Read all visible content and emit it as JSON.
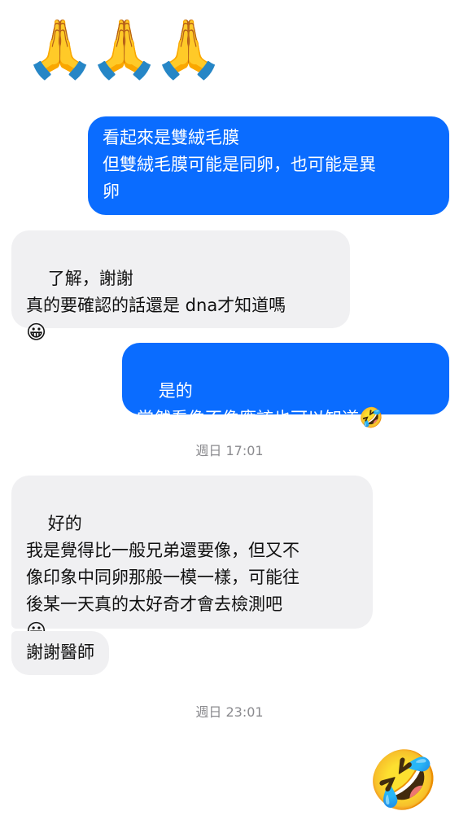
{
  "messages": {
    "m0_emoji": "🙏🙏🙏",
    "m1": "看起來是雙絨毛膜\n但雙絨毛膜可能是同卵，也可能是異\n卵",
    "m2_text": "了解，謝謝\n真的要確認的話還是 dna才知道嗎\n",
    "m2_emoji": "😀",
    "m3_text": "是的\n當然看像不像應該也可以知道",
    "m3_emoji": "🤣",
    "ts1": "週日 17:01",
    "m4_text": "好的\n我是覺得比一般兄弟還要像，但又不\n像印象中同卵那般一模一樣，可能往\n後某一天真的太好奇才會去檢測吧\n",
    "m4_emoji": "😀",
    "m5": "謝謝醫師",
    "ts2": "週日 23:01",
    "m6_emoji": "🤣"
  }
}
